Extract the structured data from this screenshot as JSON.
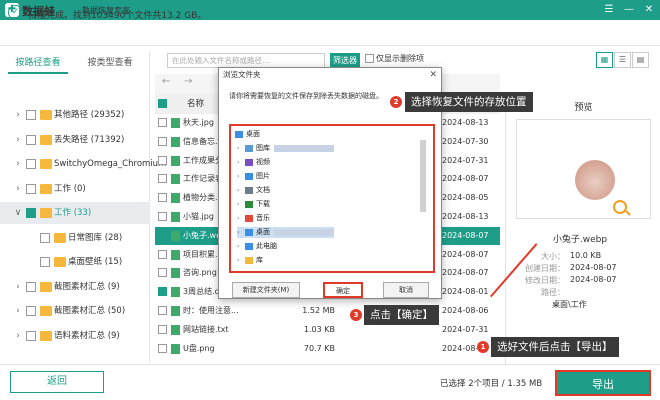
{
  "app": {
    "title": "数据蛙",
    "tagline": "数据恢复专家",
    "window_controls": [
      "☰",
      "—",
      "✕"
    ]
  },
  "scan": {
    "status": "扫描完成。找到103490个文件共13.2 GB。"
  },
  "tabs": {
    "by_path": "按路径查看",
    "by_type": "按类型查看"
  },
  "tree": [
    {
      "label": "其他路径 (29352)"
    },
    {
      "label": "丢失路径 (71392)"
    },
    {
      "label": "SwitchyOmega_Chromium"
    },
    {
      "label": "工作 (0)"
    },
    {
      "label": "工作 (33)"
    },
    {
      "label": "日常图库 (28)"
    },
    {
      "label": "桌面壁纸 (15)"
    },
    {
      "label": "截图素材汇总 (9)"
    },
    {
      "label": "截图素材汇总 (50)"
    },
    {
      "label": "语料素材汇总 (9)"
    }
  ],
  "toolbar": {
    "search_placeholder": "在此处输入文件名称或路径...",
    "filter_label": "筛选器",
    "only_deleted_label": "仅显示删除项",
    "back_arrow": "←",
    "forward_arrow": "→"
  },
  "filelist": {
    "header_name": "名称",
    "rows": [
      {
        "name": "秋天.jpg",
        "size": "",
        "date": "2024-08-13",
        "checked": false
      },
      {
        "name": "信息备忘.t",
        "size": "",
        "date": "2024-07-30",
        "checked": false
      },
      {
        "name": "工作成果分",
        "size": "",
        "date": "2024-07-31",
        "checked": false
      },
      {
        "name": "工作记录表",
        "size": "",
        "date": "2024-08-07",
        "checked": false
      },
      {
        "name": "植物分类.",
        "size": "",
        "date": "2024-08-05",
        "checked": false
      },
      {
        "name": "小猫.jpg",
        "size": "",
        "date": "2024-08-13",
        "checked": false
      },
      {
        "name": "小兔子.web",
        "size": "",
        "date": "2024-08-07",
        "checked": true
      },
      {
        "name": "项目积累.d",
        "size": "",
        "date": "2024-08-07",
        "checked": false
      },
      {
        "name": "咨询.png",
        "size": "",
        "date": "2024-08-07",
        "checked": false
      },
      {
        "name": "3周总结.doc",
        "size": "",
        "date": "2024-08-01",
        "checked": true
      },
      {
        "name": "时：使用注意...",
        "size": "1.52 MB",
        "date": "2024-08-06",
        "checked": false
      },
      {
        "name": "网站链接.txt",
        "size": "1.03 KB",
        "date": "2024-07-31",
        "checked": false
      },
      {
        "name": "U盘.png",
        "size": "70.7 KB",
        "date": "2024-08-05",
        "checked": false
      }
    ]
  },
  "preview": {
    "title": "预览",
    "filename": "小兔子.webp",
    "meta": [
      {
        "k": "大小：",
        "v": "10.0 KB"
      },
      {
        "k": "创建日期：",
        "v": "2024-08-07"
      },
      {
        "k": "修改日期：",
        "v": "2024-08-07"
      },
      {
        "k": "路径：",
        "v": ""
      },
      {
        "k": "",
        "v": "桌面\\工作"
      }
    ]
  },
  "bottom": {
    "back_label": "返回",
    "selected_info": "已选择 2个项目 / 1.35 MB",
    "export_label": "导出"
  },
  "dialog": {
    "title": "浏览文件夹",
    "close": "✕",
    "description": "请你将需要恢复的文件保存到除丢失数据的磁盘。",
    "tree": [
      {
        "label": "桌面",
        "level": 0,
        "icon_color": "#3a8ee6"
      },
      {
        "label": "图库",
        "level": 1,
        "icon_color": "#5b9bd5"
      },
      {
        "label": "视频",
        "level": 1,
        "icon_color": "#7a4fc4"
      },
      {
        "label": "图片",
        "level": 1,
        "icon_color": "#3a8ee6"
      },
      {
        "label": "文档",
        "level": 1,
        "icon_color": "#6b7a8c"
      },
      {
        "label": "下载",
        "level": 1,
        "icon_color": "#2c8a3a"
      },
      {
        "label": "音乐",
        "level": 1,
        "icon_color": "#e24a3a"
      },
      {
        "label": "桌面",
        "level": 1,
        "icon_color": "#3a8ee6"
      },
      {
        "label": "此电脑",
        "level": 1,
        "icon_color": "#3a8ee6"
      },
      {
        "label": "库",
        "level": 1,
        "icon_color": "#f5b83d"
      }
    ],
    "new_folder": "新建文件夹(M)",
    "ok": "确定",
    "cancel": "取消"
  },
  "callouts": [
    {
      "num": "2",
      "text": "选择恢复文件的存放位置"
    },
    {
      "num": "3",
      "text": "点击【确定】"
    },
    {
      "num": "1",
      "text": "选好文件后点击【导出】"
    }
  ]
}
